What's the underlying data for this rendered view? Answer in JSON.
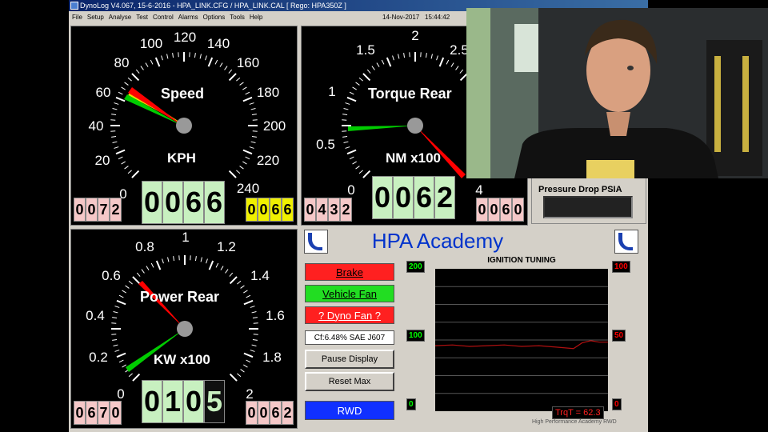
{
  "window": {
    "title": "DynoLog V4.067, 15-6-2016 - HPA_LINK.CFG / HPA_LINK.CAL [ Rego: HPA350Z ]"
  },
  "menu": {
    "items": [
      "File",
      "Setup",
      "Analyse",
      "Test",
      "Control",
      "Alarms",
      "Options",
      "Tools",
      "Help"
    ],
    "date": "14-Nov-2017",
    "time": "15:44:42"
  },
  "speed_gauge": {
    "title": "Speed",
    "unit": "KPH",
    "ticks": [
      "0",
      "20",
      "40",
      "60",
      "80",
      "100",
      "120",
      "140",
      "160",
      "180",
      "200",
      "220",
      "240"
    ],
    "value_kph": 66,
    "max_kph": 55,
    "odo_left": [
      "0",
      "0",
      "7",
      "2"
    ],
    "odo_main": [
      "0",
      "0",
      "6",
      "6"
    ],
    "odo_right": [
      "0",
      "0",
      "6",
      "6"
    ]
  },
  "torque_gauge": {
    "title": "Torque Rear",
    "unit": "NM x100",
    "ticks": [
      "0",
      "0.5",
      "1",
      "1.5",
      "2",
      "2.5"
    ],
    "odo_left": [
      "0",
      "4",
      "3",
      "2"
    ],
    "odo_main": [
      "0",
      "0",
      "6",
      "2"
    ],
    "odo_right": [
      "0",
      "0",
      "6",
      "0"
    ],
    "right_tick": "4"
  },
  "power_gauge": {
    "title": "Power Rear",
    "unit": "KW x100",
    "ticks": [
      "0",
      "0.2",
      "0.4",
      "0.6",
      "0.8",
      "1",
      "1.2",
      "1.4",
      "1.6",
      "1.8",
      "2"
    ],
    "odo_left": [
      "0",
      "6",
      "7",
      "0"
    ],
    "odo_main": [
      "0",
      "1",
      "0",
      "5"
    ],
    "odo_right": [
      "0",
      "0",
      "6",
      "2"
    ]
  },
  "pressure": {
    "label": "Pressure Drop PSIA"
  },
  "academy": {
    "title": "HPA Academy"
  },
  "controls": {
    "brake": "Brake",
    "vehicle_fan": "Vehicle Fan",
    "dyno_fan": "? Dyno Fan ?",
    "correction": "Cf:6.48% SAE J607",
    "pause": "Pause Display",
    "reset": "Reset Max",
    "drive": "RWD"
  },
  "chart": {
    "title": "IGNITION TUNING",
    "left_top": "200",
    "left_mid": "100",
    "left_bot": "0",
    "right_top": "100",
    "right_mid": "50",
    "right_bot": "0",
    "readout": "TrqT = 62.3",
    "footer": "High Performance Academy RWD"
  },
  "chart_data": {
    "type": "line",
    "title": "IGNITION TUNING",
    "xlabel": "",
    "ylabel": "",
    "ylim": [
      0,
      100
    ],
    "x": [
      0,
      10,
      20,
      30,
      40,
      50,
      60,
      70,
      80,
      85,
      90,
      95,
      100
    ],
    "series": [
      {
        "values": [
          46,
          46.5,
          45.5,
          46,
          46.5,
          45.5,
          46,
          45,
          44,
          48,
          49.5,
          48.5,
          48.5
        ]
      }
    ],
    "grid": true
  },
  "colors": {
    "brake_bg": "#ff2020",
    "fan_bg": "#22dd22",
    "dyno_fan_bg": "#ff2020",
    "rwd_bg": "#1030ff",
    "needle_red": "#ff0000",
    "needle_green": "#00cc00",
    "needle_yellow": "#e8e000",
    "trace": "#b01010"
  },
  "video": {
    "icons": [
      "person-icon"
    ]
  }
}
